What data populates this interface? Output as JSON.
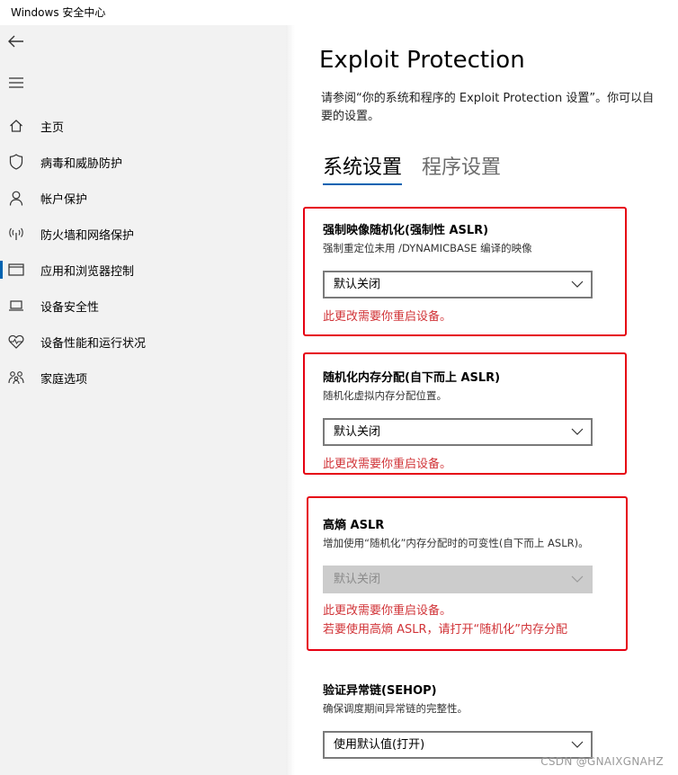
{
  "window": {
    "title": "Windows 安全中心"
  },
  "sidebar": {
    "back_icon": "back-arrow-icon",
    "menu_icon": "hamburger-menu-icon",
    "items": [
      {
        "label": "主页",
        "icon": "home-icon"
      },
      {
        "label": "病毒和威胁防护",
        "icon": "shield-icon"
      },
      {
        "label": "帐户保护",
        "icon": "person-icon"
      },
      {
        "label": "防火墙和网络保护",
        "icon": "wireless-icon"
      },
      {
        "label": "应用和浏览器控制",
        "icon": "app-window-icon",
        "active": true
      },
      {
        "label": "设备安全性",
        "icon": "laptop-icon"
      },
      {
        "label": "设备性能和运行状况",
        "icon": "heart-pulse-icon"
      },
      {
        "label": "家庭选项",
        "icon": "family-icon"
      }
    ]
  },
  "main": {
    "title": "Exploit Protection",
    "description_line1": "请参阅“你的系统和程序的 Exploit Protection 设置”。你可以自",
    "description_line2": "要的设置。",
    "tabs": [
      {
        "label": "系统设置",
        "active": true
      },
      {
        "label": "程序设置",
        "active": false
      }
    ],
    "settings": [
      {
        "title": "强制映像随机化(强制性 ASLR)",
        "description": "强制重定位未用 /DYNAMICBASE 编译的映像",
        "value": "默认关闭",
        "disabled": false,
        "warnings": [
          "此更改需要你重启设备。"
        ]
      },
      {
        "title": "随机化内存分配(自下而上 ASLR)",
        "description": "随机化虚拟内存分配位置。",
        "value": "默认关闭",
        "disabled": false,
        "warnings": [
          "此更改需要你重启设备。"
        ]
      },
      {
        "title": "高熵 ASLR",
        "description": "增加使用“随机化”内存分配时的可变性(自下而上 ASLR)。",
        "value": "默认关闭",
        "disabled": true,
        "warnings": [
          "此更改需要你重启设备。",
          "若要使用高熵 ASLR，请打开“随机化”内存分配"
        ]
      },
      {
        "title": "验证异常链(SEHOP)",
        "description": "确保调度期间异常链的完整性。",
        "value": "使用默认值(打开)",
        "disabled": false,
        "warnings": []
      }
    ]
  },
  "colors": {
    "accent": "#0063b1",
    "warning": "#d13438",
    "highlight_box": "#e60012"
  },
  "watermark": "CSDN @GNAIXGNAHZ"
}
